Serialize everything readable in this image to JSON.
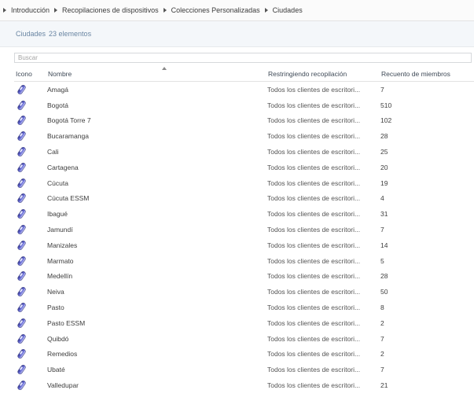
{
  "breadcrumb": [
    "Introducción",
    "Recopilaciones de dispositivos",
    "Colecciones Personalizadas",
    "Ciudades"
  ],
  "header": {
    "title": "Ciudades",
    "count": "23 elementos"
  },
  "search": {
    "placeholder": "Buscar"
  },
  "table": {
    "columns": {
      "icon": "Icono",
      "name": "Nombre",
      "restriction": "Restringiendo recopilación",
      "count": "Recuento de miembros"
    },
    "rows": [
      {
        "name": "Amagá",
        "restriction": "Todos los clientes de escritori...",
        "count": "7"
      },
      {
        "name": "Bogotá",
        "restriction": "Todos los clientes de escritori...",
        "count": "510"
      },
      {
        "name": "Bogotá Torre 7",
        "restriction": "Todos los clientes de escritori...",
        "count": "102"
      },
      {
        "name": "Bucaramanga",
        "restriction": "Todos los clientes de escritori...",
        "count": "28"
      },
      {
        "name": "Cali",
        "restriction": "Todos los clientes de escritori...",
        "count": "25"
      },
      {
        "name": "Cartagena",
        "restriction": "Todos los clientes de escritori...",
        "count": "20"
      },
      {
        "name": "Cúcuta",
        "restriction": "Todos los clientes de escritori...",
        "count": "19"
      },
      {
        "name": "Cúcuta ESSM",
        "restriction": "Todos los clientes de escritori...",
        "count": "4"
      },
      {
        "name": "Ibagué",
        "restriction": "Todos los clientes de escritori...",
        "count": "31"
      },
      {
        "name": "Jamundí",
        "restriction": "Todos los clientes de escritori...",
        "count": "7"
      },
      {
        "name": "Manizales",
        "restriction": "Todos los clientes de escritori...",
        "count": "14"
      },
      {
        "name": "Marmato",
        "restriction": "Todos los clientes de escritori...",
        "count": "5"
      },
      {
        "name": "Medellín",
        "restriction": "Todos los clientes de escritori...",
        "count": "28"
      },
      {
        "name": "Neiva",
        "restriction": "Todos los clientes de escritori...",
        "count": "50"
      },
      {
        "name": "Pasto",
        "restriction": "Todos los clientes de escritori...",
        "count": "8"
      },
      {
        "name": "Pasto ESSM",
        "restriction": "Todos los clientes de escritori...",
        "count": "2"
      },
      {
        "name": "Quibdó",
        "restriction": "Todos los clientes de escritori...",
        "count": "7"
      },
      {
        "name": "Remedios",
        "restriction": "Todos los clientes de escritori...",
        "count": "2"
      },
      {
        "name": "Ubaté",
        "restriction": "Todos los clientes de escritori...",
        "count": "7"
      },
      {
        "name": "Valledupar",
        "restriction": "Todos los clientes de escritori...",
        "count": "21"
      }
    ]
  },
  "icons": {
    "row_icon": "device-collection-icon",
    "icon_color": "#4b50c4"
  }
}
